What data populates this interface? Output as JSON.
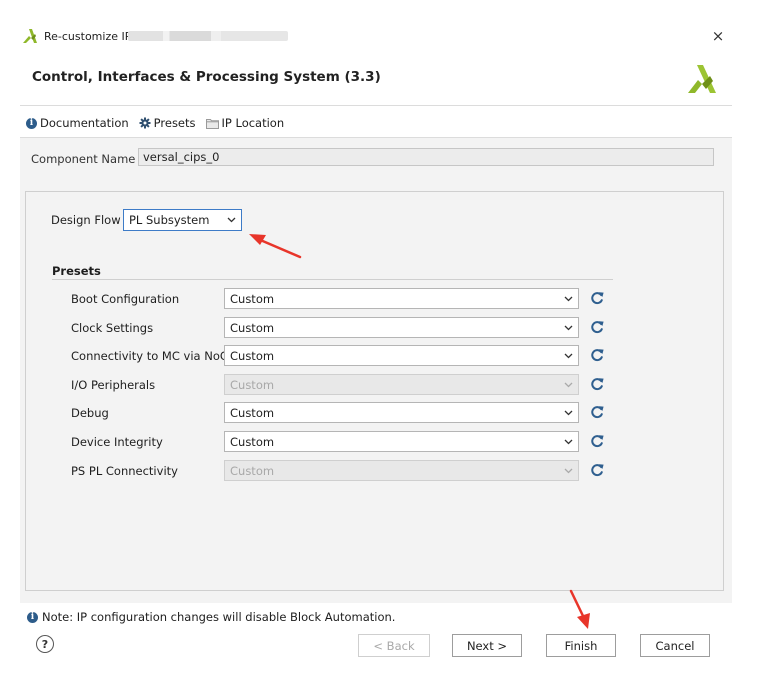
{
  "window": {
    "title": "Re-customize IP",
    "close_glyph": "×"
  },
  "header": {
    "title": "Control, Interfaces & Processing System (3.3)"
  },
  "toolbar": {
    "documentation": "Documentation",
    "presets": "Presets",
    "ip_location": "IP Location",
    "info_glyph": "i"
  },
  "component": {
    "label": "Component Name",
    "value": "versal_cips_0"
  },
  "design_flow": {
    "label": "Design Flow",
    "value": "PL Subsystem"
  },
  "presets": {
    "heading": "Presets",
    "rows": [
      {
        "label": "Boot Configuration",
        "value": "Custom",
        "enabled": true
      },
      {
        "label": "Clock Settings",
        "value": "Custom",
        "enabled": true
      },
      {
        "label": "Connectivity to MC via NoC",
        "value": "Custom",
        "enabled": true
      },
      {
        "label": "I/O Peripherals",
        "value": "Custom",
        "enabled": false
      },
      {
        "label": "Debug",
        "value": "Custom",
        "enabled": true
      },
      {
        "label": "Device Integrity",
        "value": "Custom",
        "enabled": true
      },
      {
        "label": "PS PL Connectivity",
        "value": "Custom",
        "enabled": false
      }
    ]
  },
  "footer": {
    "note": "Note: IP configuration changes will disable Block Automation.",
    "help_glyph": "?",
    "back": "< Back",
    "next": "Next >",
    "finish": "Finish",
    "cancel": "Cancel"
  },
  "colors": {
    "logo_green": "#8fb82a",
    "focus_blue": "#3d7bc7",
    "refresh_blue": "#2f5f8f",
    "arrow_red": "#e8352a"
  }
}
